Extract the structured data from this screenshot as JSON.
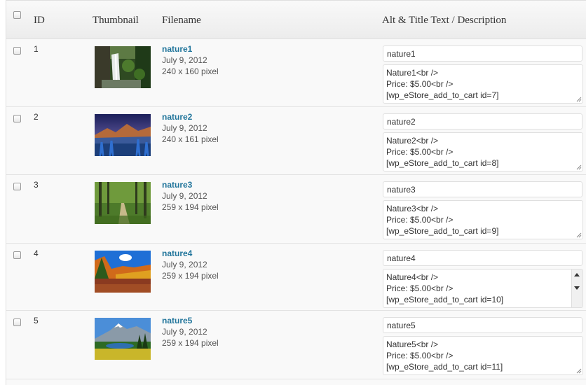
{
  "columns": {
    "id": "ID",
    "thumbnail": "Thumbnail",
    "filename": "Filename",
    "alt": "Alt & Title Text / Description"
  },
  "rows": [
    {
      "id": "1",
      "name": "nature1",
      "date": "July 9, 2012",
      "dims": "240 x 160 pixel",
      "alt": "nature1",
      "desc": [
        "Nature1<br />",
        "Price: $5.00<br />",
        "[wp_eStore_add_to_cart id=7]"
      ],
      "thumbnail_icon": "waterfall-thumbnail"
    },
    {
      "id": "2",
      "name": "nature2",
      "date": "July 9, 2012",
      "dims": "240 x 161 pixel",
      "alt": "nature2",
      "desc": [
        "Nature2<br />",
        "Price: $5.00<br />",
        "[wp_eStore_add_to_cart id=8]"
      ],
      "thumbnail_icon": "mountain-lake-thumbnail"
    },
    {
      "id": "3",
      "name": "nature3",
      "date": "July 9, 2012",
      "dims": "259 x 194 pixel",
      "alt": "nature3",
      "desc": [
        "Nature3<br />",
        "Price: $5.00<br />",
        "[wp_eStore_add_to_cart id=9]"
      ],
      "thumbnail_icon": "forest-path-thumbnail"
    },
    {
      "id": "4",
      "name": "nature4",
      "date": "July 9, 2012",
      "dims": "259 x 194 pixel",
      "alt": "nature4",
      "desc": [
        "Nature4<br />",
        "Price: $5.00<br />",
        "[wp_eStore_add_to_cart id=10]"
      ],
      "thumbnail_icon": "autumn-lake-thumbnail"
    },
    {
      "id": "5",
      "name": "nature5",
      "date": "July 9, 2012",
      "dims": "259 x 194 pixel",
      "alt": "nature5",
      "desc": [
        "Nature5<br />",
        "Price: $5.00<br />",
        "[wp_eStore_add_to_cart id=11]"
      ],
      "thumbnail_icon": "snowy-mountain-thumbnail"
    }
  ],
  "colors": {
    "link": "#21759b",
    "header_bg": "#ececec",
    "row_bg": "#f9f9f9",
    "border": "#dfdfdf"
  }
}
